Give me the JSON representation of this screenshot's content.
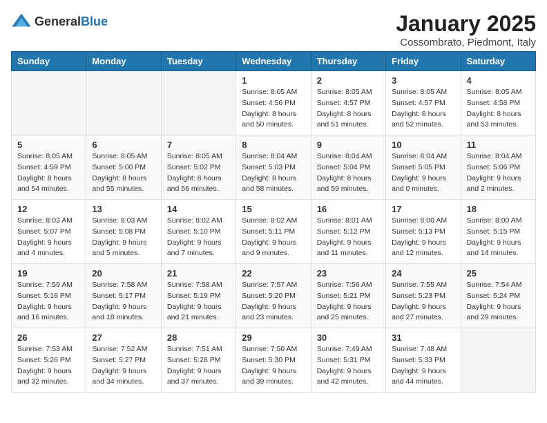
{
  "logo": {
    "general": "General",
    "blue": "Blue"
  },
  "header": {
    "month_year": "January 2025",
    "location": "Cossombrato, Piedmont, Italy"
  },
  "weekdays": [
    "Sunday",
    "Monday",
    "Tuesday",
    "Wednesday",
    "Thursday",
    "Friday",
    "Saturday"
  ],
  "weeks": [
    [
      {
        "day": "",
        "sunrise": "",
        "sunset": "",
        "daylight": ""
      },
      {
        "day": "",
        "sunrise": "",
        "sunset": "",
        "daylight": ""
      },
      {
        "day": "",
        "sunrise": "",
        "sunset": "",
        "daylight": ""
      },
      {
        "day": "1",
        "sunrise": "Sunrise: 8:05 AM",
        "sunset": "Sunset: 4:56 PM",
        "daylight": "Daylight: 8 hours and 50 minutes."
      },
      {
        "day": "2",
        "sunrise": "Sunrise: 8:05 AM",
        "sunset": "Sunset: 4:57 PM",
        "daylight": "Daylight: 8 hours and 51 minutes."
      },
      {
        "day": "3",
        "sunrise": "Sunrise: 8:05 AM",
        "sunset": "Sunset: 4:57 PM",
        "daylight": "Daylight: 8 hours and 52 minutes."
      },
      {
        "day": "4",
        "sunrise": "Sunrise: 8:05 AM",
        "sunset": "Sunset: 4:58 PM",
        "daylight": "Daylight: 8 hours and 53 minutes."
      }
    ],
    [
      {
        "day": "5",
        "sunrise": "Sunrise: 8:05 AM",
        "sunset": "Sunset: 4:59 PM",
        "daylight": "Daylight: 8 hours and 54 minutes."
      },
      {
        "day": "6",
        "sunrise": "Sunrise: 8:05 AM",
        "sunset": "Sunset: 5:00 PM",
        "daylight": "Daylight: 8 hours and 55 minutes."
      },
      {
        "day": "7",
        "sunrise": "Sunrise: 8:05 AM",
        "sunset": "Sunset: 5:02 PM",
        "daylight": "Daylight: 8 hours and 56 minutes."
      },
      {
        "day": "8",
        "sunrise": "Sunrise: 8:04 AM",
        "sunset": "Sunset: 5:03 PM",
        "daylight": "Daylight: 8 hours and 58 minutes."
      },
      {
        "day": "9",
        "sunrise": "Sunrise: 8:04 AM",
        "sunset": "Sunset: 5:04 PM",
        "daylight": "Daylight: 8 hours and 59 minutes."
      },
      {
        "day": "10",
        "sunrise": "Sunrise: 8:04 AM",
        "sunset": "Sunset: 5:05 PM",
        "daylight": "Daylight: 9 hours and 0 minutes."
      },
      {
        "day": "11",
        "sunrise": "Sunrise: 8:04 AM",
        "sunset": "Sunset: 5:06 PM",
        "daylight": "Daylight: 9 hours and 2 minutes."
      }
    ],
    [
      {
        "day": "12",
        "sunrise": "Sunrise: 8:03 AM",
        "sunset": "Sunset: 5:07 PM",
        "daylight": "Daylight: 9 hours and 4 minutes."
      },
      {
        "day": "13",
        "sunrise": "Sunrise: 8:03 AM",
        "sunset": "Sunset: 5:08 PM",
        "daylight": "Daylight: 9 hours and 5 minutes."
      },
      {
        "day": "14",
        "sunrise": "Sunrise: 8:02 AM",
        "sunset": "Sunset: 5:10 PM",
        "daylight": "Daylight: 9 hours and 7 minutes."
      },
      {
        "day": "15",
        "sunrise": "Sunrise: 8:02 AM",
        "sunset": "Sunset: 5:11 PM",
        "daylight": "Daylight: 9 hours and 9 minutes."
      },
      {
        "day": "16",
        "sunrise": "Sunrise: 8:01 AM",
        "sunset": "Sunset: 5:12 PM",
        "daylight": "Daylight: 9 hours and 11 minutes."
      },
      {
        "day": "17",
        "sunrise": "Sunrise: 8:00 AM",
        "sunset": "Sunset: 5:13 PM",
        "daylight": "Daylight: 9 hours and 12 minutes."
      },
      {
        "day": "18",
        "sunrise": "Sunrise: 8:00 AM",
        "sunset": "Sunset: 5:15 PM",
        "daylight": "Daylight: 9 hours and 14 minutes."
      }
    ],
    [
      {
        "day": "19",
        "sunrise": "Sunrise: 7:59 AM",
        "sunset": "Sunset: 5:16 PM",
        "daylight": "Daylight: 9 hours and 16 minutes."
      },
      {
        "day": "20",
        "sunrise": "Sunrise: 7:58 AM",
        "sunset": "Sunset: 5:17 PM",
        "daylight": "Daylight: 9 hours and 18 minutes."
      },
      {
        "day": "21",
        "sunrise": "Sunrise: 7:58 AM",
        "sunset": "Sunset: 5:19 PM",
        "daylight": "Daylight: 9 hours and 21 minutes."
      },
      {
        "day": "22",
        "sunrise": "Sunrise: 7:57 AM",
        "sunset": "Sunset: 5:20 PM",
        "daylight": "Daylight: 9 hours and 23 minutes."
      },
      {
        "day": "23",
        "sunrise": "Sunrise: 7:56 AM",
        "sunset": "Sunset: 5:21 PM",
        "daylight": "Daylight: 9 hours and 25 minutes."
      },
      {
        "day": "24",
        "sunrise": "Sunrise: 7:55 AM",
        "sunset": "Sunset: 5:23 PM",
        "daylight": "Daylight: 9 hours and 27 minutes."
      },
      {
        "day": "25",
        "sunrise": "Sunrise: 7:54 AM",
        "sunset": "Sunset: 5:24 PM",
        "daylight": "Daylight: 9 hours and 29 minutes."
      }
    ],
    [
      {
        "day": "26",
        "sunrise": "Sunrise: 7:53 AM",
        "sunset": "Sunset: 5:26 PM",
        "daylight": "Daylight: 9 hours and 32 minutes."
      },
      {
        "day": "27",
        "sunrise": "Sunrise: 7:52 AM",
        "sunset": "Sunset: 5:27 PM",
        "daylight": "Daylight: 9 hours and 34 minutes."
      },
      {
        "day": "28",
        "sunrise": "Sunrise: 7:51 AM",
        "sunset": "Sunset: 5:28 PM",
        "daylight": "Daylight: 9 hours and 37 minutes."
      },
      {
        "day": "29",
        "sunrise": "Sunrise: 7:50 AM",
        "sunset": "Sunset: 5:30 PM",
        "daylight": "Daylight: 9 hours and 39 minutes."
      },
      {
        "day": "30",
        "sunrise": "Sunrise: 7:49 AM",
        "sunset": "Sunset: 5:31 PM",
        "daylight": "Daylight: 9 hours and 42 minutes."
      },
      {
        "day": "31",
        "sunrise": "Sunrise: 7:48 AM",
        "sunset": "Sunset: 5:33 PM",
        "daylight": "Daylight: 9 hours and 44 minutes."
      },
      {
        "day": "",
        "sunrise": "",
        "sunset": "",
        "daylight": ""
      }
    ]
  ]
}
